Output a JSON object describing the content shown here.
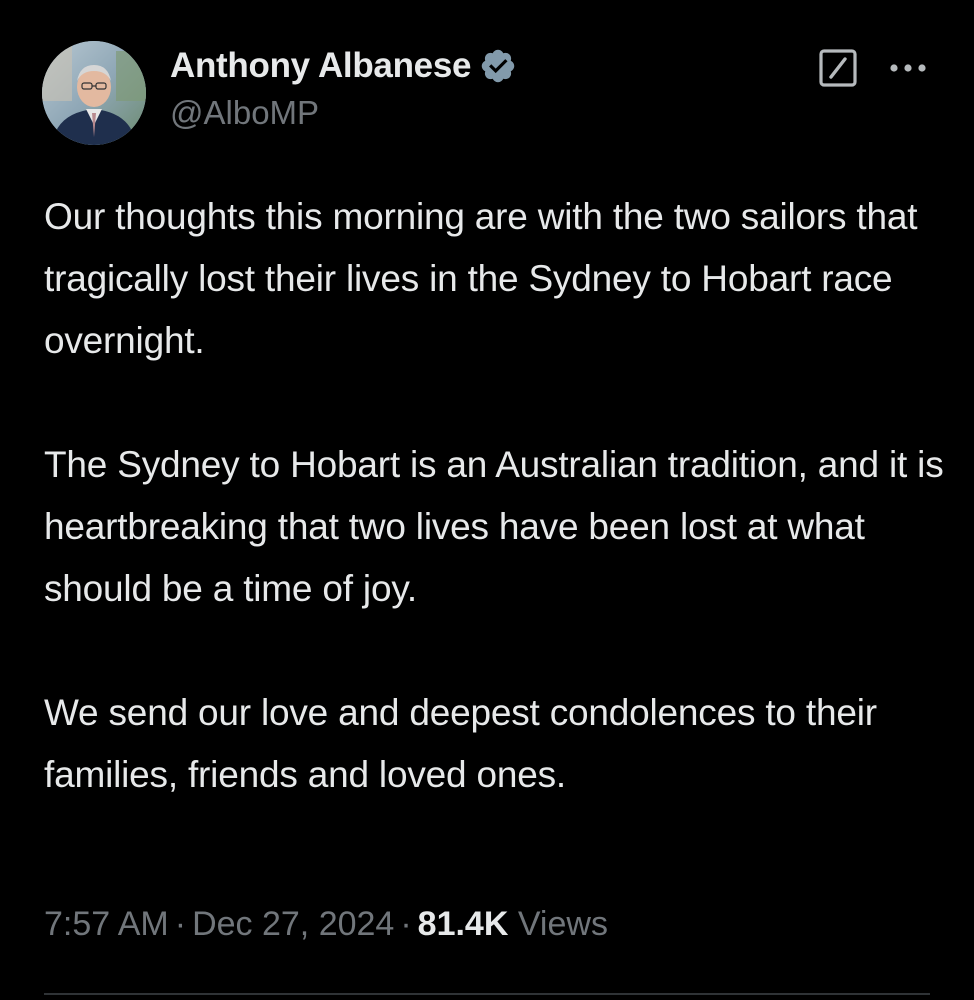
{
  "author": {
    "display_name": "Anthony Albanese",
    "handle": "@AlboMP",
    "verified": true,
    "avatar_icon": "profile-photo"
  },
  "actions": {
    "grok_icon": "grok-icon",
    "more_icon": "more-options-icon"
  },
  "tweet": {
    "paragraphs": [
      "Our thoughts this morning are with the two sailors that tragically lost their lives in the Sydney to Hobart race overnight.",
      "The Sydney to Hobart is an Australian tradition, and it is heartbreaking that two lives have been lost at what should be a time of joy.",
      "We send our love and deepest condolences to their families, friends and loved ones."
    ]
  },
  "meta": {
    "time": "7:57 AM",
    "separator": "·",
    "date": "Dec 27, 2024",
    "views_count": "81.4K",
    "views_label": "Views"
  },
  "colors": {
    "background": "#000000",
    "text_primary": "#e7e9ea",
    "text_secondary": "#71767b",
    "verified_badge": "#829aab",
    "divider": "#2f3336"
  }
}
